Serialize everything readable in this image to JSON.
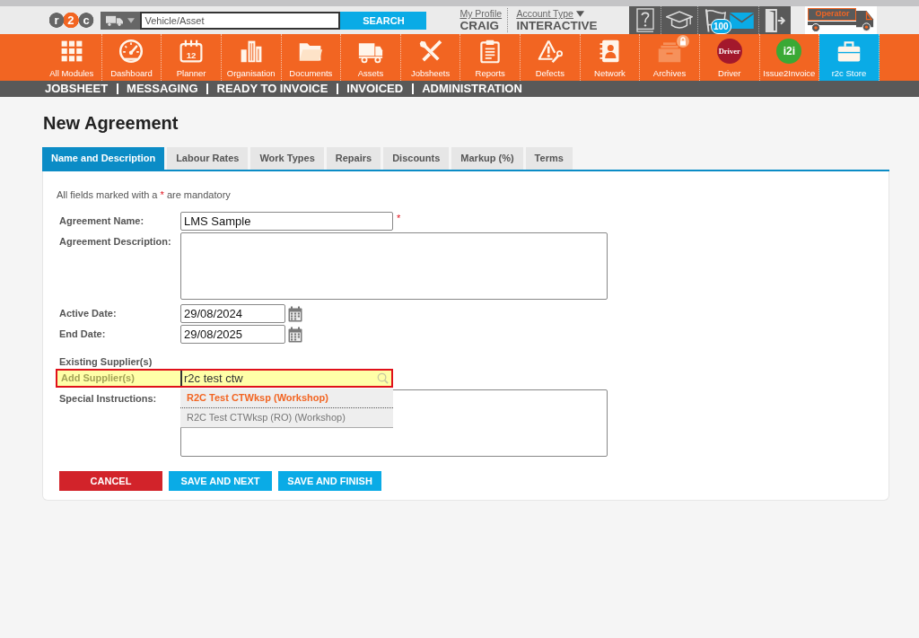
{
  "header": {
    "logo": "r2c",
    "search": {
      "placeholder": "Vehicle/Asset",
      "button": "SEARCH"
    },
    "profile": {
      "link": "My Profile",
      "name": "CRAIG"
    },
    "account": {
      "link": "Account Type",
      "value": "INTERACTIVE"
    },
    "notification_count": "100",
    "operator": "Operator"
  },
  "modules": [
    {
      "label": "All Modules",
      "kind": "icon",
      "selected": false,
      "locked": false
    },
    {
      "label": "Dashboard",
      "kind": "icon",
      "selected": false,
      "locked": false
    },
    {
      "label": "Planner",
      "kind": "icon",
      "icon_text": "12",
      "selected": false,
      "locked": false
    },
    {
      "label": "Organisation",
      "kind": "icon",
      "selected": false,
      "locked": false
    },
    {
      "label": "Documents",
      "kind": "icon",
      "selected": false,
      "locked": false
    },
    {
      "label": "Assets",
      "kind": "icon",
      "selected": false,
      "locked": false
    },
    {
      "label": "Jobsheets",
      "kind": "icon",
      "selected": false,
      "locked": false
    },
    {
      "label": "Reports",
      "kind": "icon",
      "selected": false,
      "locked": false
    },
    {
      "label": "Defects",
      "kind": "icon",
      "selected": false,
      "locked": false
    },
    {
      "label": "Network",
      "kind": "icon",
      "selected": false,
      "locked": false
    },
    {
      "label": "Archives",
      "kind": "icon",
      "selected": false,
      "locked": true
    },
    {
      "label": "Driver",
      "kind": "logo",
      "logo_text": "Driver",
      "color": "#a3182c",
      "selected": false,
      "locked": false
    },
    {
      "label": "Issue2Invoice",
      "kind": "logo",
      "logo_text": "i2i",
      "color": "#3aa935",
      "selected": false,
      "locked": false
    },
    {
      "label": "r2c Store",
      "kind": "icon",
      "selected": true,
      "locked": false
    }
  ],
  "subnav": [
    "JOBSHEET",
    "MESSAGING",
    "READY TO INVOICE",
    "INVOICED",
    "ADMINISTRATION"
  ],
  "page_title": "New Agreement",
  "tabs": [
    {
      "label": "Name and Description",
      "selected": true
    },
    {
      "label": "Labour Rates",
      "selected": false
    },
    {
      "label": "Work Types",
      "selected": false
    },
    {
      "label": "Repairs",
      "selected": false
    },
    {
      "label": "Discounts",
      "selected": false
    },
    {
      "label": "Markup (%)",
      "selected": false
    },
    {
      "label": "Terms",
      "selected": false
    }
  ],
  "form": {
    "mandatory_note": {
      "before": "All fields marked with a",
      "mark": "*",
      "after": "are mandatory"
    },
    "fields": [
      {
        "label": "Agreement Name:",
        "kind": "text",
        "value": "LMS Sample",
        "mark": "*"
      },
      {
        "label": "Agreement Description:",
        "kind": "textarea"
      },
      {
        "label": "Active Date:",
        "kind": "date",
        "value": "29/08/2024"
      },
      {
        "label": "End Date:",
        "kind": "date",
        "value": "29/08/2025"
      }
    ],
    "existing_suppliers": {
      "label": "Existing Supplier(s)"
    },
    "add_supplier": {
      "label": "Add Supplier(s)",
      "value": "r2c test ctw",
      "focused": true,
      "suggestions": [
        {
          "label": "R2C Test CTWksp (Workshop)",
          "selected": true
        },
        {
          "label": "R2C Test CTWksp (RO) (Workshop)",
          "selected": false
        }
      ]
    },
    "special_instructions": {
      "label": "Special Instructions:"
    },
    "buttons": [
      {
        "label": "CANCEL",
        "kind": "cancel"
      },
      {
        "label": "SAVE AND NEXT",
        "kind": "save"
      },
      {
        "label": "SAVE AND FINISH",
        "kind": "save"
      }
    ]
  }
}
